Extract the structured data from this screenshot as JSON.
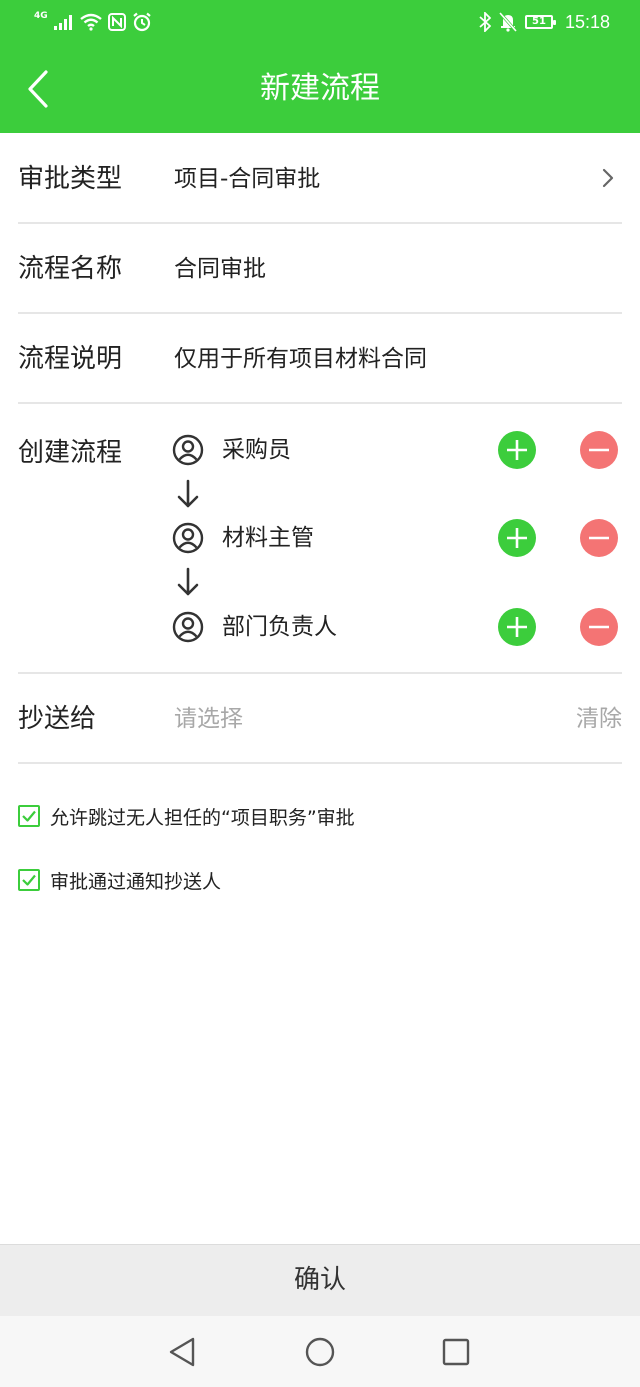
{
  "status_bar": {
    "network_label": "4G",
    "battery": "51",
    "time": "15:18",
    "icons": [
      "signal-icon",
      "wifi-icon",
      "nfc-icon",
      "alarm-icon",
      "bluetooth-icon",
      "mute-bell-icon",
      "battery-icon"
    ]
  },
  "header": {
    "title": "新建流程",
    "back_icon": "back-chevron-icon"
  },
  "form": {
    "approval_type": {
      "label": "审批类型",
      "value": "项目-合同审批"
    },
    "process_name": {
      "label": "流程名称",
      "value": "合同审批"
    },
    "process_desc": {
      "label": "流程说明",
      "value": "仅用于所有项目材料合同"
    },
    "create_flow": {
      "label": "创建流程",
      "steps": [
        {
          "name": "采购员"
        },
        {
          "name": "材料主管"
        },
        {
          "name": "部门负责人"
        }
      ]
    },
    "cc": {
      "label": "抄送给",
      "placeholder": "请选择",
      "clear": "清除"
    }
  },
  "options": [
    {
      "label": "允许跳过无人担任的“项目职务”审批",
      "checked": true
    },
    {
      "label": "审批通过通知抄送人",
      "checked": true
    }
  ],
  "confirm_label": "确认",
  "colors": {
    "primary_green": "#3ccd3c",
    "remove_red": "#f47474",
    "placeholder_gray": "#a8a8a8"
  }
}
